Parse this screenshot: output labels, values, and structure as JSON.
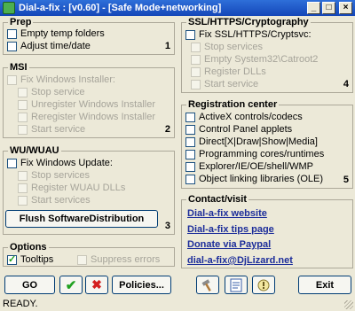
{
  "window": {
    "title": "Dial-a-fix : [v0.60] - [Safe Mode+networking]",
    "min": "_",
    "max": "□",
    "close": "×"
  },
  "prep": {
    "title": "Prep",
    "num": "1",
    "items": [
      "Empty temp folders",
      "Adjust time/date"
    ]
  },
  "msi": {
    "title": "MSI",
    "num": "2",
    "items": [
      "Fix Windows Installer:",
      "Stop service",
      "Unregister Windows Installer",
      "Reregister Windows Installer",
      "Start service"
    ]
  },
  "wu": {
    "title": "WU/WUAU",
    "num": "3",
    "items": [
      "Fix Windows Update:",
      "Stop services",
      "Register WUAU DLLs",
      "Start services"
    ],
    "flush": "Flush SoftwareDistribution"
  },
  "options": {
    "title": "Options",
    "tooltips": "Tooltips",
    "suppress": "Suppress errors"
  },
  "ssl": {
    "title": "SSL/HTTPS/Cryptography",
    "num": "4",
    "items": [
      "Fix SSL/HTTPS/Cryptsvc:",
      "Stop services",
      "Empty System32\\Catroot2",
      "Register DLLs",
      "Start service"
    ]
  },
  "reg": {
    "title": "Registration center",
    "num": "5",
    "items": [
      "ActiveX controls/codecs",
      "Control Panel applets",
      "Direct[X|Draw|Show|Media]",
      "Programming cores/runtimes",
      "Explorer/IE/OE/shell/WMP",
      "Object linking libraries (OLE)"
    ]
  },
  "contact": {
    "title": "Contact/visit",
    "links": [
      "Dial-a-fix website",
      "Dial-a-fix tips page",
      "Donate via Paypal",
      "dial-a-fix@DjLizard.net"
    ]
  },
  "buttons": {
    "go": "GO",
    "check": "✔",
    "x": "✖",
    "policies": "Policies...",
    "exit": "Exit"
  },
  "status": "READY.",
  "colors": {
    "accent": "#1c2d9a",
    "check_green": "#21a121",
    "x_red": "#d42020"
  }
}
